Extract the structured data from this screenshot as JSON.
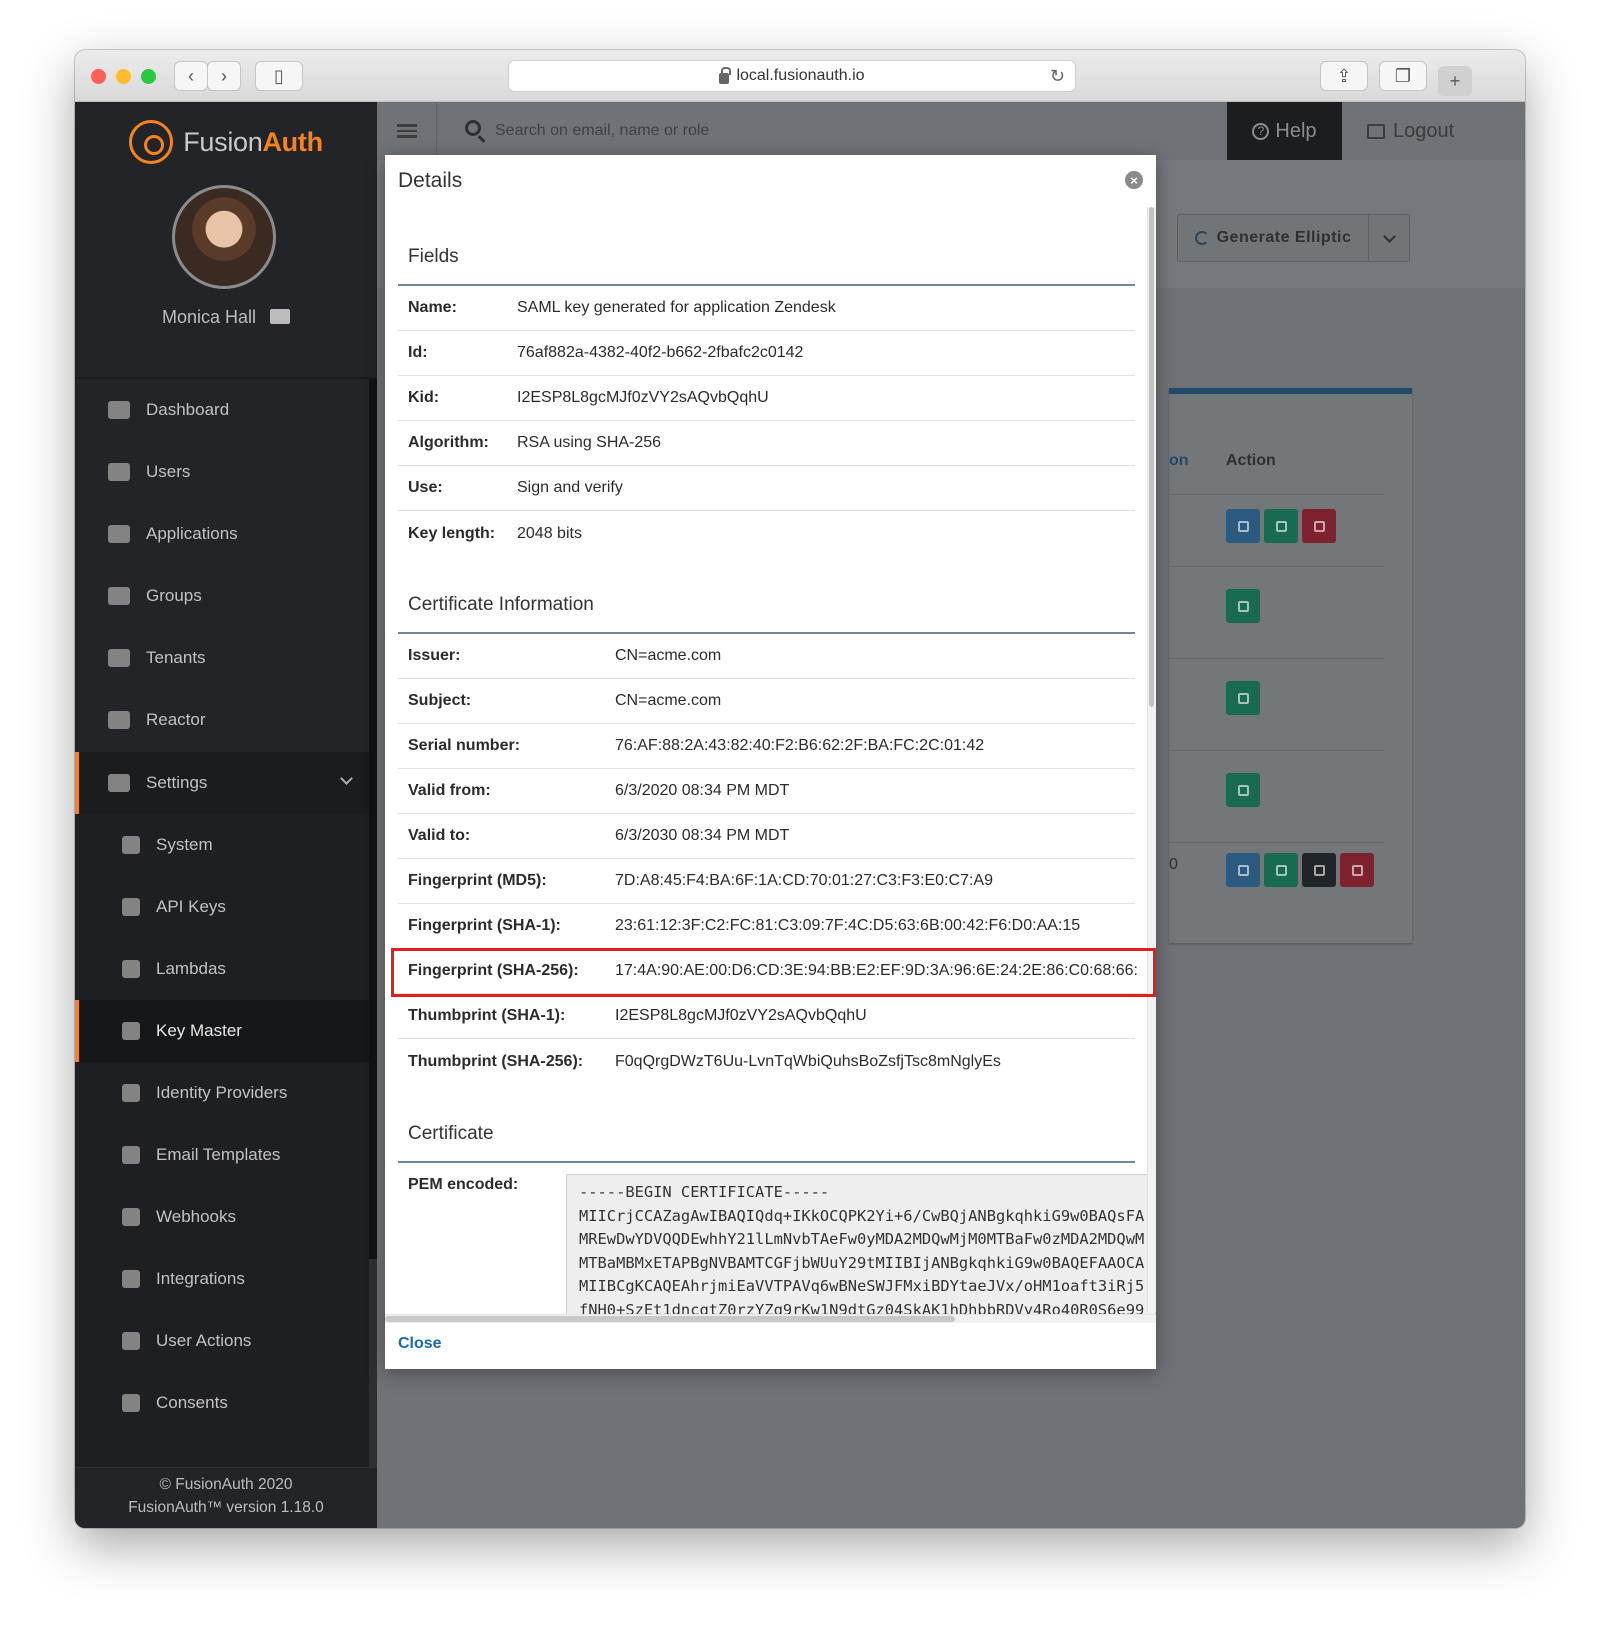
{
  "browser": {
    "url": "local.fusionauth.io",
    "traffic_lights": [
      "#fe5f57",
      "#febc2e",
      "#28c840"
    ]
  },
  "brand": {
    "name_part1": "Fusion",
    "name_part2": "Auth",
    "accent": "#f58320"
  },
  "user": {
    "name": "Monica Hall"
  },
  "sidebar": {
    "items": [
      {
        "label": "Dashboard",
        "icon": "columns-icon"
      },
      {
        "label": "Users",
        "icon": "users-icon"
      },
      {
        "label": "Applications",
        "icon": "cube-icon"
      },
      {
        "label": "Groups",
        "icon": "object-group-icon"
      },
      {
        "label": "Tenants",
        "icon": "building-icon"
      },
      {
        "label": "Reactor",
        "icon": "radiation-icon"
      },
      {
        "label": "Settings",
        "icon": "sliders-icon"
      },
      {
        "label": "System",
        "icon": "cog-icon"
      },
      {
        "label": "API Keys",
        "icon": "key-icon"
      },
      {
        "label": "Lambdas",
        "icon": "code-icon"
      },
      {
        "label": "Key Master",
        "icon": "lock-icon"
      },
      {
        "label": "Identity Providers",
        "icon": "id-badge-icon"
      },
      {
        "label": "Email Templates",
        "icon": "envelope-icon"
      },
      {
        "label": "Webhooks",
        "icon": "rss-icon"
      },
      {
        "label": "Integrations",
        "icon": "exchange-icon"
      },
      {
        "label": "User Actions",
        "icon": "trophy-icon"
      },
      {
        "label": "Consents",
        "icon": "check-icon"
      }
    ],
    "footer_line1": "© FusionAuth 2020",
    "footer_line2": "FusionAuth™ version 1.18.0"
  },
  "topbar": {
    "search_placeholder": "Search on email, name or role",
    "help_label": "Help",
    "logout_label": "Logout"
  },
  "page": {
    "generate_button": "Generate Elliptic",
    "column_fragment": "on",
    "column_action": "Action",
    "row_fragment": "0"
  },
  "modal": {
    "title": "Details",
    "close_label": "Close",
    "fields_title": "Fields",
    "fields": [
      {
        "key": "Name:",
        "value": "SAML key generated for application Zendesk"
      },
      {
        "key": "Id:",
        "value": "76af882a-4382-40f2-b662-2fbafc2c0142"
      },
      {
        "key": "Kid:",
        "value": "I2ESP8L8gcMJf0zVY2sAQvbQqhU"
      },
      {
        "key": "Algorithm:",
        "value": "RSA using SHA-256"
      },
      {
        "key": "Use:",
        "value": "Sign and verify"
      },
      {
        "key": "Key length:",
        "value": "2048 bits"
      }
    ],
    "cert_title": "Certificate Information",
    "cert_fields": [
      {
        "key": "Issuer:",
        "value": "CN=acme.com"
      },
      {
        "key": "Subject:",
        "value": "CN=acme.com"
      },
      {
        "key": "Serial number:",
        "value": "76:AF:88:2A:43:82:40:F2:B6:62:2F:BA:FC:2C:01:42"
      },
      {
        "key": "Valid from:",
        "value": "6/3/2020 08:34 PM MDT"
      },
      {
        "key": "Valid to:",
        "value": "6/3/2030 08:34 PM MDT"
      },
      {
        "key": "Fingerprint (MD5):",
        "value": "7D:A8:45:F4:BA:6F:1A:CD:70:01:27:C3:F3:E0:C7:A9"
      },
      {
        "key": "Fingerprint (SHA-1):",
        "value": "23:61:12:3F:C2:FC:81:C3:09:7F:4C:D5:63:6B:00:42:F6:D0:AA:15"
      },
      {
        "key": "Fingerprint (SHA-256):",
        "value": "17:4A:90:AE:00:D6:CD:3E:94:BB:E2:EF:9D:3A:96:6E:24:2E:86:C0:68:66:"
      },
      {
        "key": "Thumbprint (SHA-1):",
        "value": "I2ESP8L8gcMJf0zVY2sAQvbQqhU"
      },
      {
        "key": "Thumbprint (SHA-256):",
        "value": "F0qQrgDWzT6Uu-LvnTqWbiQuhsBoZsfjTsc8mNglyEs"
      }
    ],
    "certificate_title": "Certificate",
    "pem_label": "PEM encoded:",
    "pem_lines": [
      "-----BEGIN CERTIFICATE-----",
      "MIICrjCCAZagAwIBAQIQdq+IKkOCQPK2Yi+6/CwBQjANBgkqhkiG9w0BAQsFA",
      "MREwDwYDVQQDEwhhY21lLmNvbTAeFw0yMDA2MDQwMjM0MTBaFw0zMDA2MDQwM",
      "MTBaMBMxETAPBgNVBAMTCGFjbWUuY29tMIIBIjANBgkqhkiG9w0BAQEFAAOCA",
      "MIIBCgKCAQEAhrjmiEaVVTPAVq6wBNeSWJFMxiBDYtaeJVx/oHM1oaft3iRj5",
      "fNH0+SzEt1dncqtZ0rzYZq9rKw1N9dtGz04SkAK1hDhbbRDVy4Ro40R0S6e99"
    ],
    "highlight_color": "#e02020"
  }
}
